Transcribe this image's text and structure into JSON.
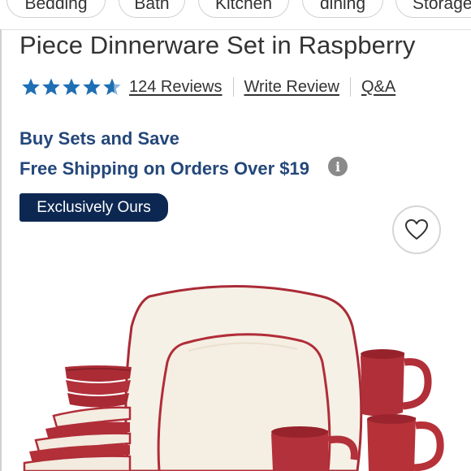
{
  "categories": [
    "Bedding",
    "Bath",
    "Kitchen",
    "dining",
    "Storage"
  ],
  "product": {
    "title": "Piece Dinnerware Set in Raspberry",
    "rating": 4.5,
    "reviews_link": "124 Reviews",
    "write_review": "Write Review",
    "qa_link": "Q&A"
  },
  "promos": {
    "line1": "Buy Sets and Save",
    "line2": "Free Shipping on Orders Over $19",
    "info_icon": "info-icon"
  },
  "badge": "Exclusively Ours",
  "colors": {
    "brand_blue": "#24477a",
    "star_blue": "#1f6fb4",
    "badge_navy": "#0c2852",
    "raspberry": "#b52a35"
  },
  "icons": {
    "favorite": "heart-outline-icon",
    "rating": "star-icon"
  }
}
